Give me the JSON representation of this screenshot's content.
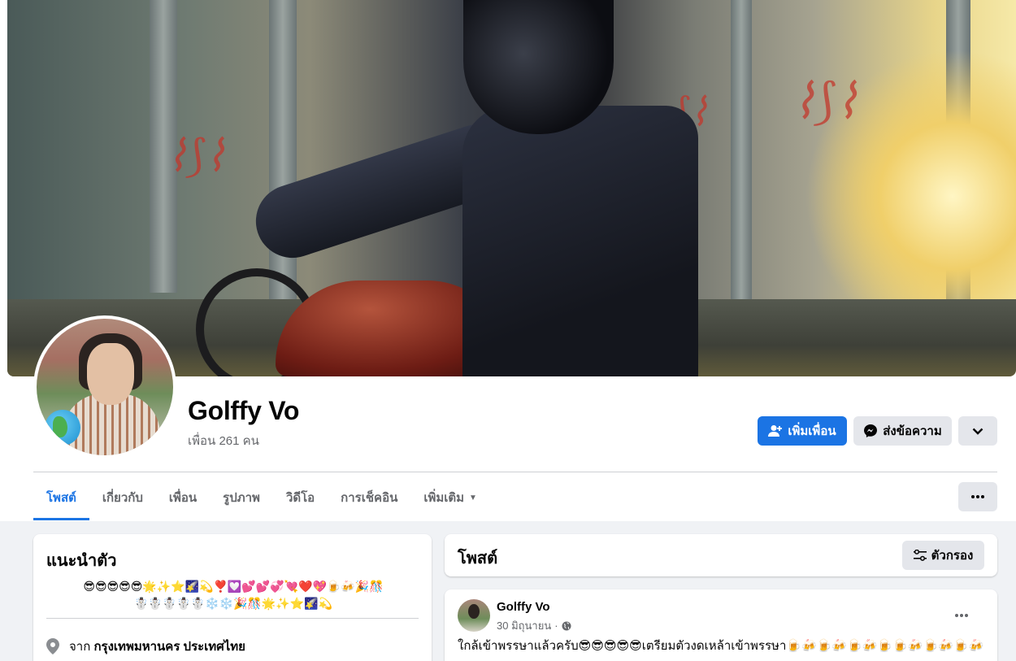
{
  "profile": {
    "name": "Golffy Vo",
    "friends_count": "เพื่อน 261 คน"
  },
  "actions": {
    "add_friend": "เพิ่มเพื่อน",
    "message": "ส่งข้อความ"
  },
  "tabs": [
    {
      "label": "โพสต์",
      "active": true
    },
    {
      "label": "เกี่ยวกับ"
    },
    {
      "label": "เพื่อน"
    },
    {
      "label": "รูปภาพ"
    },
    {
      "label": "วิดีโอ"
    },
    {
      "label": "การเช็คอิน"
    },
    {
      "label": "เพิ่มเติม"
    }
  ],
  "intro": {
    "title": "แนะนำตัว",
    "bio_line1": "😎😎😎😎😎🌟✨⭐🌠💫❣️💟💕💕💞💘❤️💖🍺🍻🎉🎊",
    "bio_line2": "☃️☃️☃️☃️☃️❄️❄️🎉🎊🌟✨⭐🌠💫",
    "location_prefix": "จาก",
    "location": "กรุงเทพมหานคร ประเทศไทย"
  },
  "posts_section": {
    "title": "โพสต์",
    "filter_label": "ตัวกรอง"
  },
  "post": {
    "author": "Golffy Vo",
    "date": "30 มิถุนายน",
    "separator": "·",
    "text": "ใกล้เข้าพรรษาแล้วครับ😎😎😎😎😎เตรียมตัวงดเหล้าเข้าพรรษา🍺🍻🍺🍻🍺🍻🍺🍺🍻🍺🍻🍺🍻🍺⭐🌟"
  },
  "colors": {
    "accent": "#1b74e4",
    "secondary_button": "#e4e6eb",
    "page_background": "#f0f2f5",
    "muted_text": "#65676b"
  },
  "icons": {
    "add_friend": "person-plus-icon",
    "message": "messenger-icon",
    "more": "chevron-down-icon",
    "tab_more": "ellipsis-icon",
    "filter": "sliders-icon",
    "location": "map-pin-icon",
    "audience": "globe-icon",
    "post_options": "ellipsis-icon"
  }
}
